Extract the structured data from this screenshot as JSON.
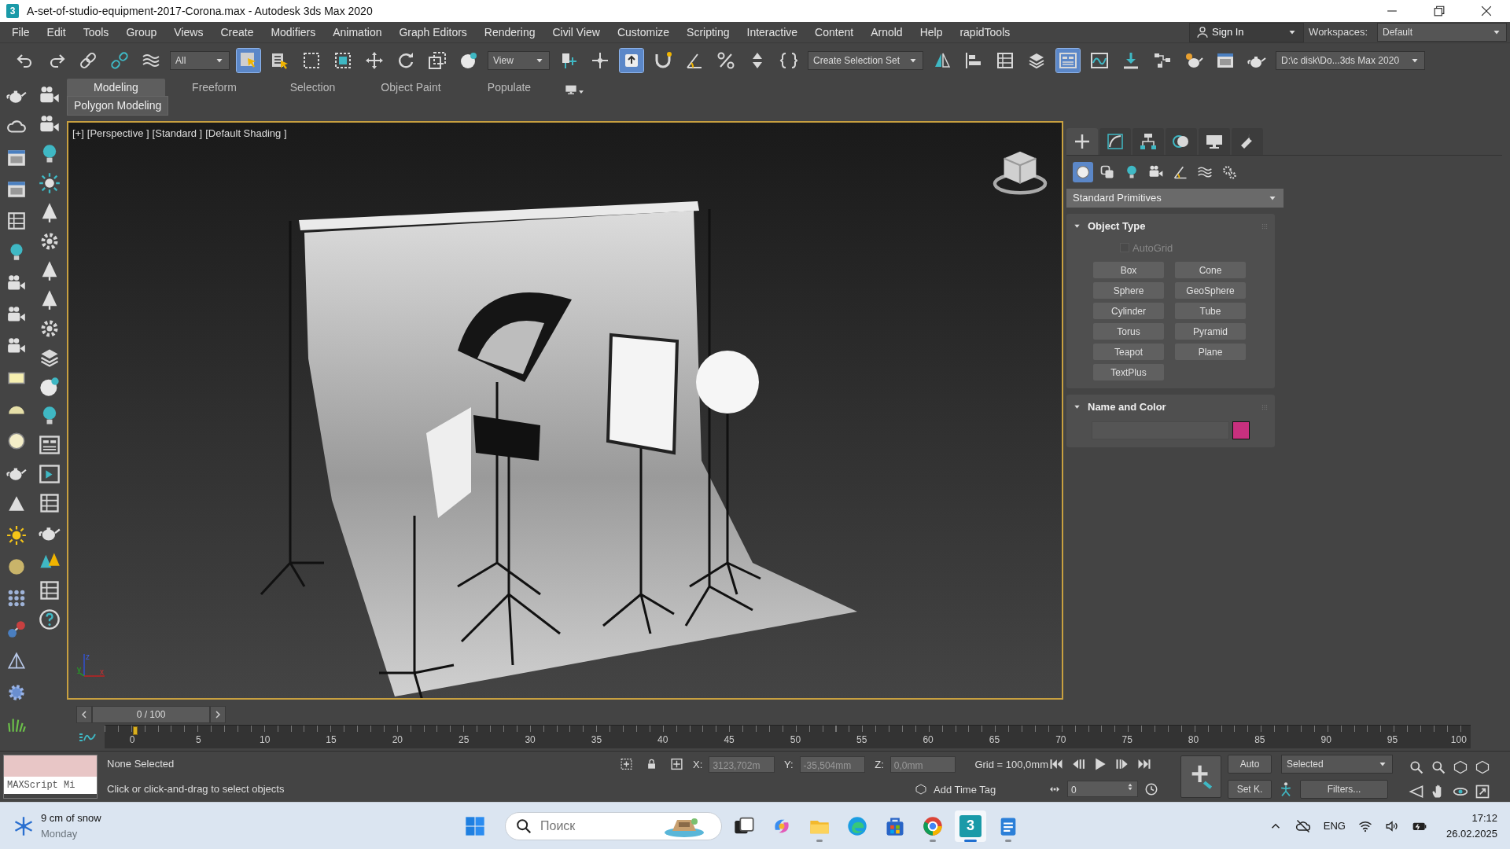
{
  "title_bar": {
    "logo": "3",
    "title": "A-set-of-studio-equipment-2017-Corona.max - Autodesk 3ds Max 2020"
  },
  "menu": [
    "File",
    "Edit",
    "Tools",
    "Group",
    "Views",
    "Create",
    "Modifiers",
    "Animation",
    "Graph Editors",
    "Rendering",
    "Civil View",
    "Customize",
    "Scripting",
    "Interactive",
    "Content",
    "Arnold",
    "Help",
    "rapidTools"
  ],
  "account": {
    "sign_in": "Sign In",
    "workspaces_label": "Workspaces:",
    "workspace": "Default"
  },
  "toolbar": [
    {
      "kind": "tool",
      "selected": false
    },
    {
      "kind": "tool",
      "selected": false
    },
    {
      "kind": "tool",
      "selected": false
    },
    {
      "kind": "tool",
      "selected": false
    },
    {
      "kind": "tool",
      "selected": false
    },
    {
      "kind": "dropdown",
      "value": "All"
    },
    {
      "kind": "tool",
      "selected": true
    },
    {
      "kind": "tool",
      "selected": false
    },
    {
      "kind": "tool",
      "selected": false
    },
    {
      "kind": "tool",
      "selected": false
    },
    {
      "kind": "tool",
      "selected": false
    },
    {
      "kind": "tool",
      "selected": false
    },
    {
      "kind": "tool",
      "selected": false
    },
    {
      "kind": "tool",
      "selected": false
    },
    {
      "kind": "dropdown",
      "value": "View"
    },
    {
      "kind": "tool",
      "selected": false
    },
    {
      "kind": "tool",
      "selected": false
    },
    {
      "kind": "tool",
      "selected": true
    },
    {
      "kind": "tool",
      "selected": false
    },
    {
      "kind": "tool",
      "selected": false
    },
    {
      "kind": "tool",
      "selected": false
    },
    {
      "kind": "tool",
      "selected": false
    },
    {
      "kind": "tool",
      "selected": false
    },
    {
      "kind": "dropdown",
      "value": "Create Selection Set"
    },
    {
      "kind": "tool",
      "selected": false
    },
    {
      "kind": "tool",
      "selected": false
    },
    {
      "kind": "tool",
      "selected": false
    },
    {
      "kind": "tool",
      "selected": false
    },
    {
      "kind": "tool",
      "selected": true
    },
    {
      "kind": "tool",
      "selected": false
    },
    {
      "kind": "tool",
      "selected": false
    },
    {
      "kind": "tool",
      "selected": false
    },
    {
      "kind": "tool",
      "selected": false
    },
    {
      "kind": "tool",
      "selected": false
    },
    {
      "kind": "tool",
      "selected": false
    },
    {
      "kind": "dropdown",
      "value": "D:\\c disk\\Do...3ds Max 2020"
    }
  ],
  "ribbon": {
    "tabs": [
      {
        "label": "Modeling",
        "selected": true
      },
      {
        "label": "Freeform",
        "selected": false
      },
      {
        "label": "Selection",
        "selected": false
      },
      {
        "label": "Object Paint",
        "selected": false
      },
      {
        "label": "Populate",
        "selected": false
      }
    ],
    "panel": "Polygon Modeling"
  },
  "viewport": {
    "labels": [
      "[+]",
      "[Perspective ]",
      "[Standard ]",
      "[Default Shading ]"
    ],
    "axes": [
      "z",
      "y",
      "x"
    ],
    "scene": {
      "kind": "picture"
    }
  },
  "command_panel": {
    "tabs": [
      {
        "selected": true
      },
      {
        "selected": false
      },
      {
        "selected": false
      },
      {
        "selected": false
      },
      {
        "selected": false
      },
      {
        "selected": false
      }
    ],
    "categories": [
      {
        "selected": true
      },
      {
        "selected": false
      },
      {
        "selected": false
      },
      {
        "selected": false
      },
      {
        "selected": false
      },
      {
        "selected": false
      },
      {
        "selected": false
      }
    ],
    "dropdown": "Standard Primitives",
    "object_type": {
      "title": "Object Type",
      "autogrid": {
        "label": "AutoGrid",
        "checked": false,
        "disabled": true
      },
      "buttons": [
        "Box",
        "Cone",
        "Sphere",
        "GeoSphere",
        "Cylinder",
        "Tube",
        "Torus",
        "Pyramid",
        "Teapot",
        "Plane",
        "TextPlus"
      ]
    },
    "name_and_color": {
      "title": "Name and Color",
      "color": "#c8307e"
    }
  },
  "timeline": {
    "frame": "0 / 100",
    "ticks": [
      "0",
      "5",
      "10",
      "15",
      "20",
      "25",
      "30",
      "35",
      "40",
      "45",
      "50",
      "55",
      "60",
      "65",
      "70",
      "75",
      "80",
      "85",
      "90",
      "95",
      "100"
    ]
  },
  "status": {
    "maxscript": "MAXScript Mi",
    "selection": "None Selected",
    "prompt": "Click or click-and-drag to select objects",
    "x_label": "X:",
    "x": "3123,702m",
    "y_label": "Y:",
    "y": "-35,504mm",
    "z_label": "Z:",
    "z": "0,0mm",
    "grid": "Grid = 100,0mm",
    "add_time_tag": "Add Time Tag",
    "frame": "0",
    "auto": "Auto",
    "set_key": "Set K.",
    "key_filter": "Selected",
    "filters": "Filters..."
  },
  "taskbar": {
    "weather": "9 cm of snow",
    "day": "Monday",
    "search_placeholder": "Поиск",
    "apps": [
      {
        "running": false,
        "selected": false
      },
      {
        "running": false,
        "selected": false
      },
      {
        "running": true,
        "selected": false
      },
      {
        "running": false,
        "selected": false
      },
      {
        "running": false,
        "selected": false
      },
      {
        "running": true,
        "selected": false
      },
      {
        "running": true,
        "selected": true,
        "glyph": "3"
      },
      {
        "running": true,
        "selected": false
      }
    ],
    "language": "ENG",
    "time": "17:12",
    "date": "26.02.2025"
  }
}
